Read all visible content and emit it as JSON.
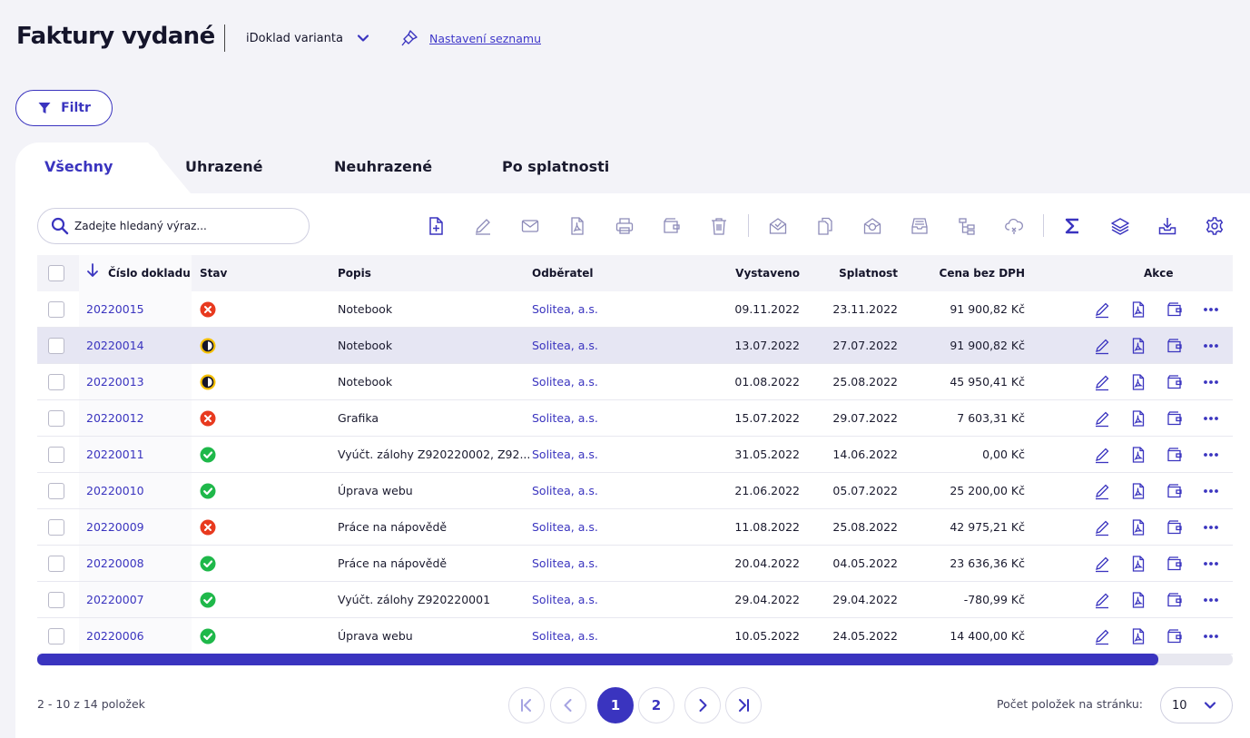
{
  "header": {
    "title": "Faktury vydané",
    "variant_label": "iDoklad varianta",
    "list_settings_label": "Nastavení seznamu"
  },
  "filter": {
    "label": "Filtr"
  },
  "tabs": [
    {
      "label": "Všechny",
      "active": true
    },
    {
      "label": "Uhrazené",
      "active": false
    },
    {
      "label": "Neuhrazené",
      "active": false
    },
    {
      "label": "Po splatnosti",
      "active": false
    }
  ],
  "search": {
    "placeholder": "Zadejte hledaný výraz..."
  },
  "toolbar_icons": [
    "new-document-icon",
    "edit-icon",
    "email-icon",
    "pdf-icon",
    "print-icon",
    "payment-icon",
    "delete-icon",
    "open-email-icon",
    "copy-icon",
    "stamp-icon",
    "archive-icon",
    "hierarchy-icon",
    "cloud-sync-icon",
    "sum-icon",
    "layers-icon",
    "download-icon",
    "settings-icon"
  ],
  "table": {
    "columns": {
      "number": "Číslo dokladu",
      "status": "Stav",
      "description": "Popis",
      "customer": "Odběratel",
      "issued": "Vystaveno",
      "due": "Splatnost",
      "amount": "Cena bez DPH",
      "actions": "Akce"
    },
    "rows": [
      {
        "number": "20220015",
        "status": "unpaid",
        "description": "Notebook",
        "customer": "Solitea, a.s.",
        "issued": "09.11.2022",
        "due": "23.11.2022",
        "amount": "91 900,82 Kč"
      },
      {
        "number": "20220014",
        "status": "partial",
        "description": "Notebook",
        "customer": "Solitea, a.s.",
        "issued": "13.07.2022",
        "due": "27.07.2022",
        "amount": "91 900,82 Kč"
      },
      {
        "number": "20220013",
        "status": "partial",
        "description": "Notebook",
        "customer": "Solitea, a.s.",
        "issued": "01.08.2022",
        "due": "25.08.2022",
        "amount": "45 950,41 Kč"
      },
      {
        "number": "20220012",
        "status": "unpaid",
        "description": "Grafika",
        "customer": "Solitea, a.s.",
        "issued": "15.07.2022",
        "due": "29.07.2022",
        "amount": "7 603,31 Kč"
      },
      {
        "number": "20220011",
        "status": "paid",
        "description": "Vyúčt. zálohy Z920220002, Z92...",
        "customer": "Solitea, a.s.",
        "issued": "31.05.2022",
        "due": "14.06.2022",
        "amount": "0,00 Kč"
      },
      {
        "number": "20220010",
        "status": "paid",
        "description": "Úprava webu",
        "customer": "Solitea, a.s.",
        "issued": "21.06.2022",
        "due": "05.07.2022",
        "amount": "25 200,00 Kč"
      },
      {
        "number": "20220009",
        "status": "unpaid",
        "description": "Práce na nápovědě",
        "customer": "Solitea, a.s.",
        "issued": "11.08.2022",
        "due": "25.08.2022",
        "amount": "42 975,21 Kč"
      },
      {
        "number": "20220008",
        "status": "paid",
        "description": "Práce na nápovědě",
        "customer": "Solitea, a.s.",
        "issued": "20.04.2022",
        "due": "04.05.2022",
        "amount": "23 636,36 Kč"
      },
      {
        "number": "20220007",
        "status": "paid",
        "description": "Vyúčt. zálohy Z920220001",
        "customer": "Solitea, a.s.",
        "issued": "29.04.2022",
        "due": "29.04.2022",
        "amount": "-780,99 Kč"
      },
      {
        "number": "20220006",
        "status": "paid",
        "description": "Úprava webu",
        "customer": "Solitea, a.s.",
        "issued": "10.05.2022",
        "due": "24.05.2022",
        "amount": "14 400,00 Kč"
      }
    ]
  },
  "footer": {
    "count_text": "2 - 10 z 14 položek",
    "pages": [
      "1",
      "2"
    ],
    "current_page": "1",
    "per_page_label": "Počet položek na stránku:",
    "per_page_value": "10"
  },
  "colors": {
    "accent": "#3a34bf",
    "paid": "#1fb84a",
    "unpaid": "#e83a1f",
    "partial": "#f5c000"
  }
}
